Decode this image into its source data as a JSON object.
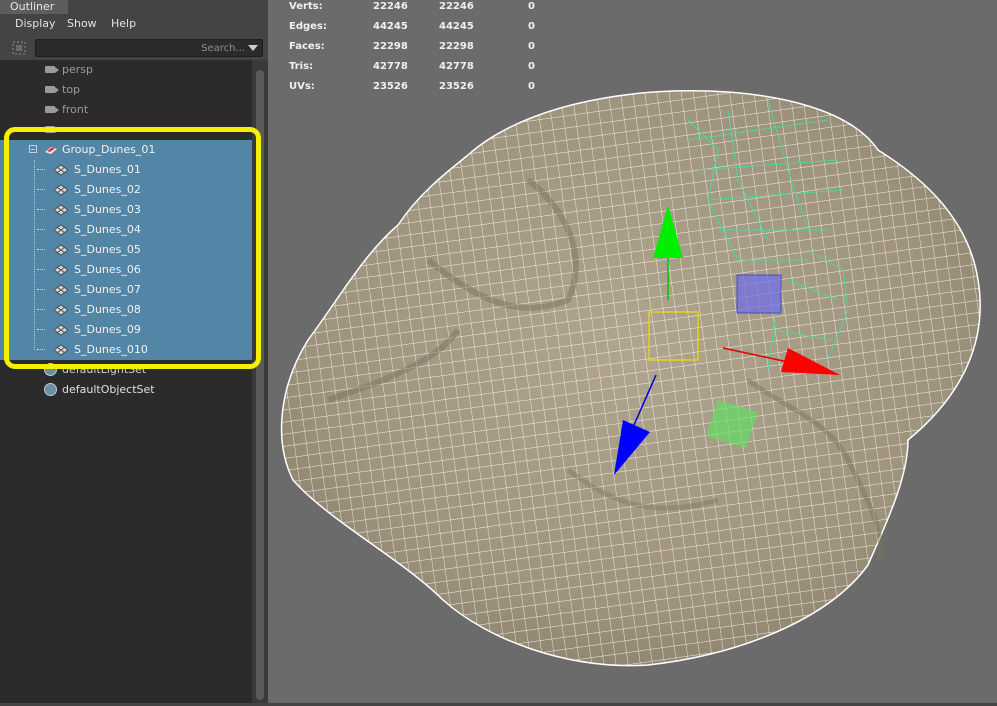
{
  "outliner": {
    "title": "Outliner",
    "menu": [
      "Display",
      "Show",
      "Help"
    ],
    "search_placeholder": "Search...",
    "cameras": [
      "persp",
      "top",
      "front"
    ],
    "group": {
      "label": "Group_Dunes_01",
      "children": [
        "S_Dunes_01",
        "S_Dunes_02",
        "S_Dunes_03",
        "S_Dunes_04",
        "S_Dunes_05",
        "S_Dunes_06",
        "S_Dunes_07",
        "S_Dunes_08",
        "S_Dunes_09",
        "S_Dunes_010"
      ]
    },
    "sets": [
      "defaultLightSet",
      "defaultObjectSet"
    ],
    "highlight_color": "#f4f000",
    "selection_color": "#5285a6"
  },
  "hud": {
    "rows": [
      {
        "label": "Verts:",
        "v1": "22246",
        "v2": "22246",
        "v3": "0"
      },
      {
        "label": "Edges:",
        "v1": "44245",
        "v2": "44245",
        "v3": "0"
      },
      {
        "label": "Faces:",
        "v1": "22298",
        "v2": "22298",
        "v3": "0"
      },
      {
        "label": "Tris:",
        "v1": "42778",
        "v2": "42778",
        "v3": "0"
      },
      {
        "label": "UVs:",
        "v1": "23526",
        "v2": "23526",
        "v3": "0"
      }
    ]
  },
  "viewport": {
    "background": "#6b6b6b",
    "mesh_color": "#a49983",
    "wire_color": "#ffffff",
    "manipulator": {
      "x_color": "#ff0000",
      "y_color": "#00ee00",
      "z_color": "#0000ff"
    }
  }
}
